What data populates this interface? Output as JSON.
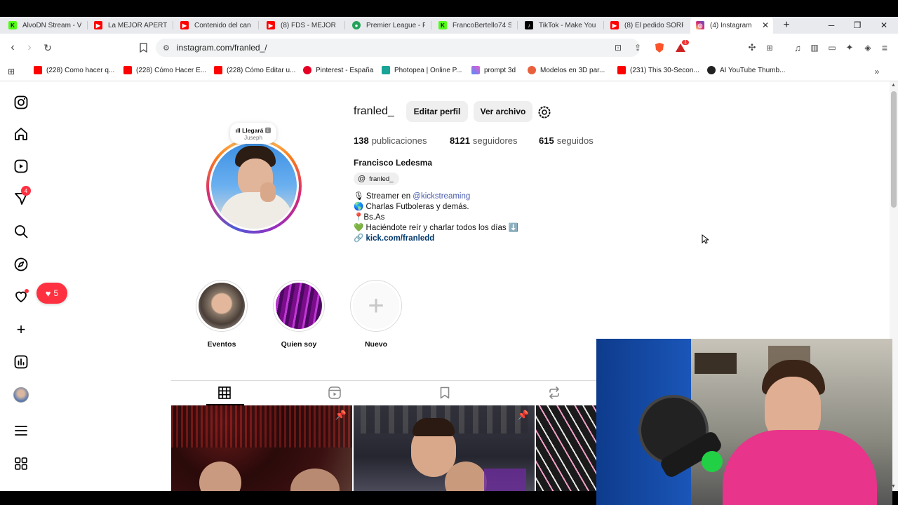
{
  "browser": {
    "tabs": [
      {
        "title": "AlvoDN Stream - V",
        "icon": "kick-icon",
        "color": "#53fc18",
        "left": 0
      },
      {
        "title": "La MEJOR APERTU",
        "icon": "youtube-icon",
        "color": "#ff0000"
      },
      {
        "title": "Contenido del can",
        "icon": "youtube-icon",
        "color": "#ff0000"
      },
      {
        "title": "(8) FDS - MEJOR C",
        "icon": "youtube-icon",
        "color": "#ff0000"
      },
      {
        "title": "Premier League - F",
        "icon": "premier-icon",
        "color": "#21a35a"
      },
      {
        "title": "FrancoBertello74 S",
        "icon": "kick-icon",
        "color": "#53fc18"
      },
      {
        "title": "TikTok - Make You",
        "icon": "tiktok-icon",
        "color": "#000000"
      },
      {
        "title": "(8) El pedido SORF",
        "icon": "youtube-icon",
        "color": "#ff0000"
      },
      {
        "title": "(4) Instagram",
        "icon": "instagram-icon",
        "color": "#d62976"
      }
    ],
    "url": "instagram.com/franled_/",
    "brave_badge": "1",
    "bookmarks": [
      {
        "title": "(228) Como hacer q...",
        "color": "#ff0000"
      },
      {
        "title": "(228) Cómo Hacer E...",
        "color": "#ff0000"
      },
      {
        "title": "(228) Cómo Editar u...",
        "color": "#ff0000"
      },
      {
        "title": "Pinterest - España",
        "color": "#e60023"
      },
      {
        "title": "Photopea | Online P...",
        "color": "#18a497"
      },
      {
        "title": "prompt 3d",
        "color": "#8e7cf5"
      },
      {
        "title": "Modelos en 3D par...",
        "color": "#e8613c"
      },
      {
        "title": "(231) This 30-Secon...",
        "color": "#ff0000"
      },
      {
        "title": "AI YouTube Thumb...",
        "color": "#222222"
      }
    ]
  },
  "sidebar": {
    "messages_badge": "4",
    "notifications_popup": "5"
  },
  "profile": {
    "username": "franled_",
    "edit_button": "Editar perfil",
    "archive_button": "Ver archivo",
    "note_title": "Llegará",
    "note_sub": "Juseph",
    "posts_count": "138",
    "posts_label": "publicaciones",
    "followers_count": "8121",
    "followers_label": "seguidores",
    "following_count": "615",
    "following_label": "seguidos",
    "full_name": "Francisco Ledesma",
    "threads_handle": "franled_",
    "bio_line1_prefix": "Streamer en ",
    "bio_line1_mention": "@kickstreaming",
    "bio_line2": "Charlas Futboleras y demás.",
    "bio_line3": "Bs.As",
    "bio_line4": "Haciéndote reír y charlar todos los días",
    "link": "kick.com/franledd"
  },
  "highlights": [
    {
      "label": "Eventos"
    },
    {
      "label": "Quien soy"
    },
    {
      "label": "Nuevo"
    }
  ]
}
